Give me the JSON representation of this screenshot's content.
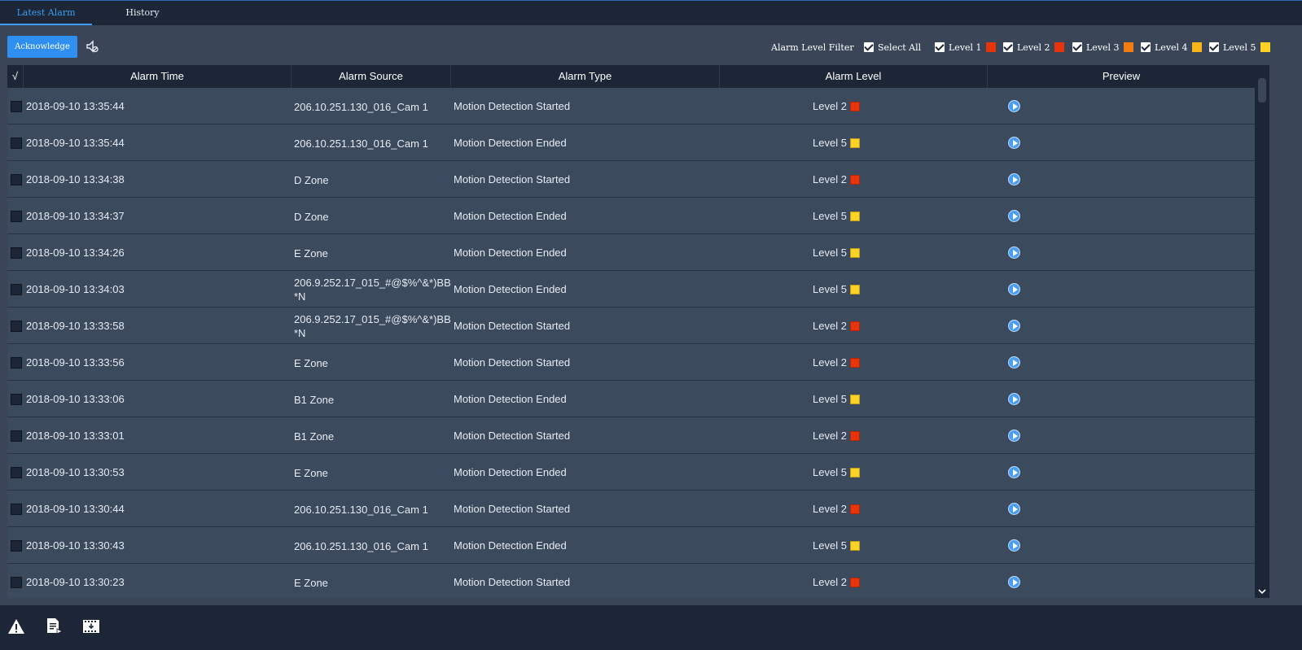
{
  "tabs": [
    {
      "label": "Latest Alarm",
      "active": true
    },
    {
      "label": "History",
      "active": false
    }
  ],
  "toolbar": {
    "acknowledge_label": "Acknowledge",
    "sound_icon": "sound-off-icon"
  },
  "filter": {
    "label": "Alarm Level Filter",
    "select_all": {
      "label": "Select All",
      "checked": true
    },
    "levels": [
      {
        "label": "Level 1",
        "checked": true,
        "color": "#e8340a"
      },
      {
        "label": "Level 2",
        "checked": true,
        "color": "#e8340a"
      },
      {
        "label": "Level 3",
        "checked": true,
        "color": "#f37b12"
      },
      {
        "label": "Level 4",
        "checked": true,
        "color": "#f8b51a"
      },
      {
        "label": "Level 5",
        "checked": true,
        "color": "#fcd225"
      }
    ]
  },
  "table": {
    "headers": [
      "√",
      "Alarm Time",
      "Alarm Source",
      "Alarm Type",
      "Alarm Level",
      "Preview"
    ],
    "rows": [
      {
        "time": "2018-09-10 13:35:44",
        "source": "206.10.251.130_016_Cam 1",
        "type": "Motion Detection Started",
        "level": "Level 2",
        "level_color": "#e8340a"
      },
      {
        "time": "2018-09-10 13:35:44",
        "source": "206.10.251.130_016_Cam 1",
        "type": "Motion Detection Ended",
        "level": "Level 5",
        "level_color": "#fcd225"
      },
      {
        "time": "2018-09-10 13:34:38",
        "source": "D Zone",
        "type": "Motion Detection Started",
        "level": "Level 2",
        "level_color": "#e8340a"
      },
      {
        "time": "2018-09-10 13:34:37",
        "source": "D Zone",
        "type": "Motion Detection Ended",
        "level": "Level 5",
        "level_color": "#fcd225"
      },
      {
        "time": "2018-09-10 13:34:26",
        "source": "E Zone",
        "type": "Motion Detection Ended",
        "level": "Level 5",
        "level_color": "#fcd225"
      },
      {
        "time": "2018-09-10 13:34:03",
        "source": "206.9.252.17_015_#@$%^&*)BB *N",
        "type": "Motion Detection Ended",
        "level": "Level 5",
        "level_color": "#fcd225"
      },
      {
        "time": "2018-09-10 13:33:58",
        "source": "206.9.252.17_015_#@$%^&*)BB *N",
        "type": "Motion Detection Started",
        "level": "Level 2",
        "level_color": "#e8340a"
      },
      {
        "time": "2018-09-10 13:33:56",
        "source": "E Zone",
        "type": "Motion Detection Started",
        "level": "Level 2",
        "level_color": "#e8340a"
      },
      {
        "time": "2018-09-10 13:33:06",
        "source": "B1 Zone",
        "type": "Motion Detection Ended",
        "level": "Level 5",
        "level_color": "#fcd225"
      },
      {
        "time": "2018-09-10 13:33:01",
        "source": "B1 Zone",
        "type": "Motion Detection Started",
        "level": "Level 2",
        "level_color": "#e8340a"
      },
      {
        "time": "2018-09-10 13:30:53",
        "source": "E Zone",
        "type": "Motion Detection Ended",
        "level": "Level 5",
        "level_color": "#fcd225"
      },
      {
        "time": "2018-09-10 13:30:44",
        "source": "206.10.251.130_016_Cam 1",
        "type": "Motion Detection Started",
        "level": "Level 2",
        "level_color": "#e8340a"
      },
      {
        "time": "2018-09-10 13:30:43",
        "source": "206.10.251.130_016_Cam 1",
        "type": "Motion Detection Ended",
        "level": "Level 5",
        "level_color": "#fcd225"
      },
      {
        "time": "2018-09-10 13:30:23",
        "source": "E Zone",
        "type": "Motion Detection Started",
        "level": "Level 2",
        "level_color": "#e8340a"
      }
    ]
  },
  "footer": {
    "icons": [
      "warning-icon",
      "report-export-icon",
      "video-download-icon"
    ]
  }
}
